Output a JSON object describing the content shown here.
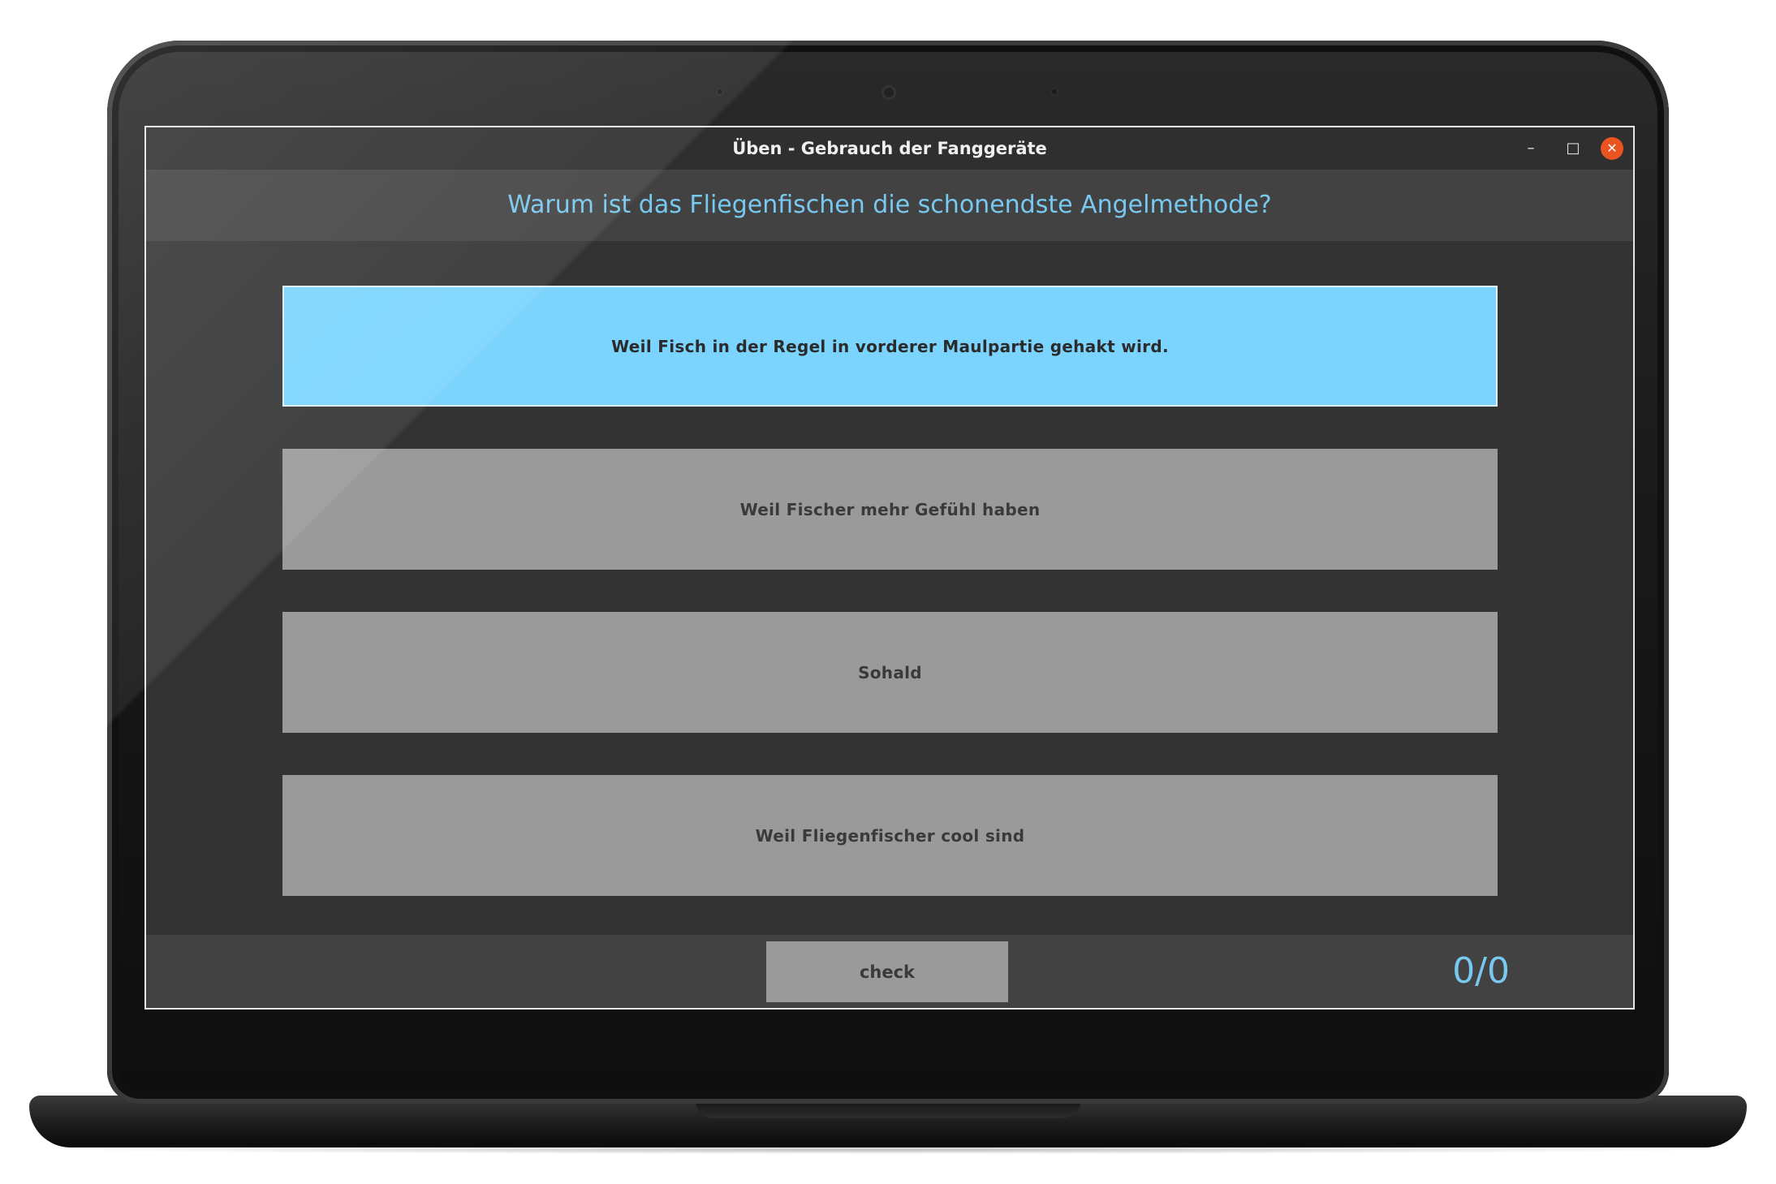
{
  "window": {
    "title": "Üben - Gebrauch der Fanggeräte",
    "controls": {
      "minimize": "–",
      "maximize": "□",
      "close": "✕"
    }
  },
  "quiz": {
    "question": "Warum ist das Fliegenfischen die schonendste Angelmethode?",
    "answers": [
      {
        "label": "Weil Fisch in der Regel in vorderer Maulpartie gehakt wird.",
        "selected": true
      },
      {
        "label": "Weil Fischer mehr Gefühl haben",
        "selected": false
      },
      {
        "label": "Sohald",
        "selected": false
      },
      {
        "label": "Weil Fliegenfischer cool sind",
        "selected": false
      }
    ],
    "check_label": "check",
    "score": "0/0"
  },
  "colors": {
    "accent": "#78c8ef",
    "selected_answer": "#7ad4fd",
    "answer": "#9a9a9a",
    "close_button": "#e95420"
  }
}
